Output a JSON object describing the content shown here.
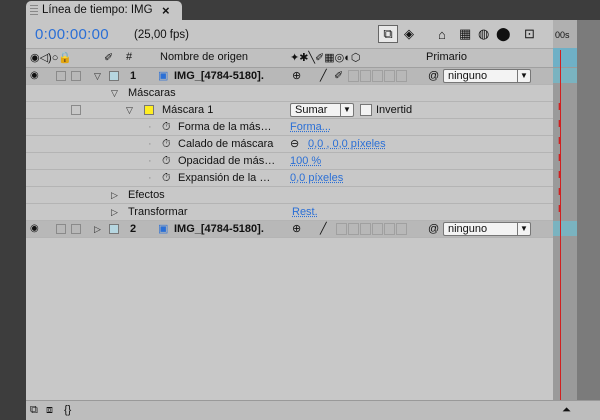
{
  "tab": {
    "title": "Línea de tiempo: IMG",
    "close": "×"
  },
  "header": {
    "timecode": "0:00:00:00",
    "fps": "(25,00 fps)"
  },
  "columns": {
    "switches_left": "◉◁)○🔒",
    "label_col": "✐",
    "number": "#",
    "source_name": "Nombre de origen",
    "switches": "✦✱╲✐▦◎◐⬡",
    "parent": "Primario"
  },
  "layers": [
    {
      "number": "1",
      "name": "IMG_[4784-5180].",
      "parent": "ninguno"
    },
    {
      "number": "2",
      "name": "IMG_[4784-5180].",
      "parent": "ninguno"
    }
  ],
  "masks": {
    "group_label": "Máscaras",
    "mask1": {
      "name": "Máscara 1",
      "mode": "Sumar",
      "invert_label": "Invertid"
    },
    "props": [
      {
        "label": "Forma de la más…",
        "value": "Forma..."
      },
      {
        "label": "Calado de máscara",
        "value": "0,0 , 0,0 píxeles"
      },
      {
        "label": "Opacidad de más…",
        "value": "100 %"
      },
      {
        "label": "Expansión de la …",
        "value": "0,0 píxeles"
      }
    ]
  },
  "effects_label": "Efectos",
  "transform": {
    "label": "Transformar",
    "value": "Rest."
  },
  "timeline": {
    "ruler_label": "00s"
  },
  "colors": {
    "accent": "#2a6fd6",
    "label_yellow": "#ffee22",
    "label_blue": "#b6d6e0",
    "playhead": "#d02020"
  }
}
